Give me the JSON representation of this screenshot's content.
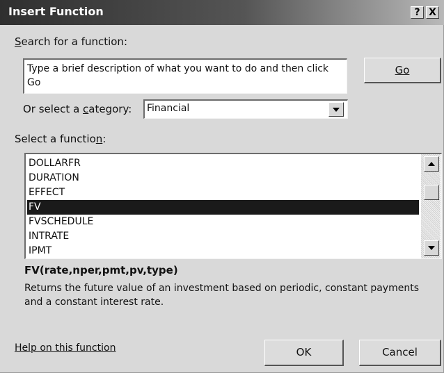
{
  "window": {
    "title": "Insert Function",
    "help_button": "?",
    "close_button": "X"
  },
  "search": {
    "label": "Search for a function:",
    "label_accel": "S",
    "label_rest": "earch for a function:",
    "value": "Type a brief description of what you want to do and then click Go",
    "go_button": "Go"
  },
  "category": {
    "label_pre": "Or select a ",
    "label_accel": "c",
    "label_post": "ategory:",
    "selected": "Financial"
  },
  "function_list": {
    "label_pre": "Select a functio",
    "label_accel": "n",
    "label_post": ":",
    "items": [
      "DOLLARFR",
      "DURATION",
      "EFFECT",
      "FV",
      "FVSCHEDULE",
      "INTRATE",
      "IPMT"
    ],
    "selected": "FV"
  },
  "description": {
    "signature": "FV(rate,nper,pmt,pv,type)",
    "text": "Returns the future value of an investment based on periodic, constant payments and a constant interest rate."
  },
  "footer": {
    "help_link": "Help on this function",
    "ok": "OK",
    "cancel": "Cancel"
  },
  "colors": {
    "selection": "#1a1a1a",
    "dialog": "#d9d9d9"
  }
}
